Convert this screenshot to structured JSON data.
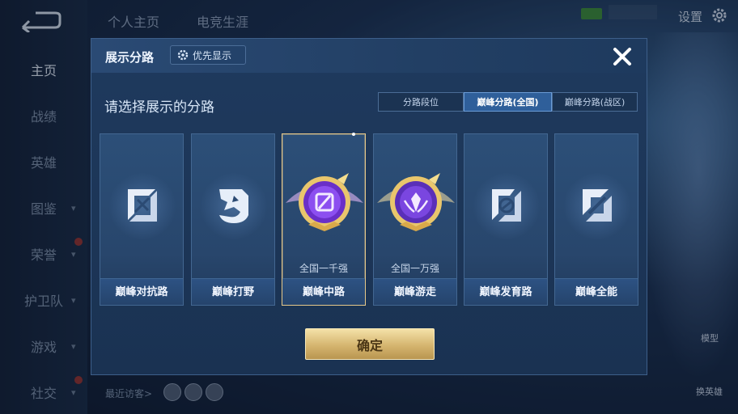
{
  "sidebar": {
    "items": [
      {
        "label": "主页",
        "active": true,
        "chevron": false
      },
      {
        "label": "战绩",
        "active": false,
        "chevron": false
      },
      {
        "label": "英雄",
        "active": false,
        "chevron": false
      },
      {
        "label": "图鉴",
        "active": false,
        "chevron": true
      },
      {
        "label": "荣誉",
        "active": false,
        "chevron": true
      },
      {
        "label": "护卫队",
        "active": false,
        "chevron": true
      },
      {
        "label": "游戏",
        "active": false,
        "chevron": true
      },
      {
        "label": "社交",
        "active": false,
        "chevron": true
      }
    ]
  },
  "top_tabs": [
    "个人主页",
    "电竞生涯"
  ],
  "settings_label": "设置",
  "visitors_label": "最近访客>",
  "bottom_right": [
    "模型",
    "换英雄"
  ],
  "modal": {
    "title": "展示分路",
    "priority_button": "优先显示",
    "subtitle": "请选择展示的分路",
    "tabs": [
      {
        "label": "分路段位",
        "active": false
      },
      {
        "label": "巅峰分路(全国)",
        "active": true
      },
      {
        "label": "巅峰分路(战区)",
        "active": false
      }
    ],
    "cards": [
      {
        "name": "巅峰对抗路",
        "rank": "",
        "icon": "clash-lane-icon",
        "selected": false
      },
      {
        "name": "巅峰打野",
        "rank": "",
        "icon": "jungle-icon",
        "selected": false
      },
      {
        "name": "巅峰中路",
        "rank": "全国一千强",
        "icon": "mid-lane-medal-icon",
        "selected": true
      },
      {
        "name": "巅峰游走",
        "rank": "全国一万强",
        "icon": "roam-medal-icon",
        "selected": false
      },
      {
        "name": "巅峰发育路",
        "rank": "",
        "icon": "farm-lane-icon",
        "selected": false
      },
      {
        "name": "巅峰全能",
        "rank": "",
        "icon": "all-round-icon",
        "selected": false
      }
    ],
    "confirm_button": "确定"
  },
  "colors": {
    "accent_gold": "#d5b56f",
    "active_tab": "#2f5f9a",
    "medal_purple": "#6a2fc8"
  }
}
